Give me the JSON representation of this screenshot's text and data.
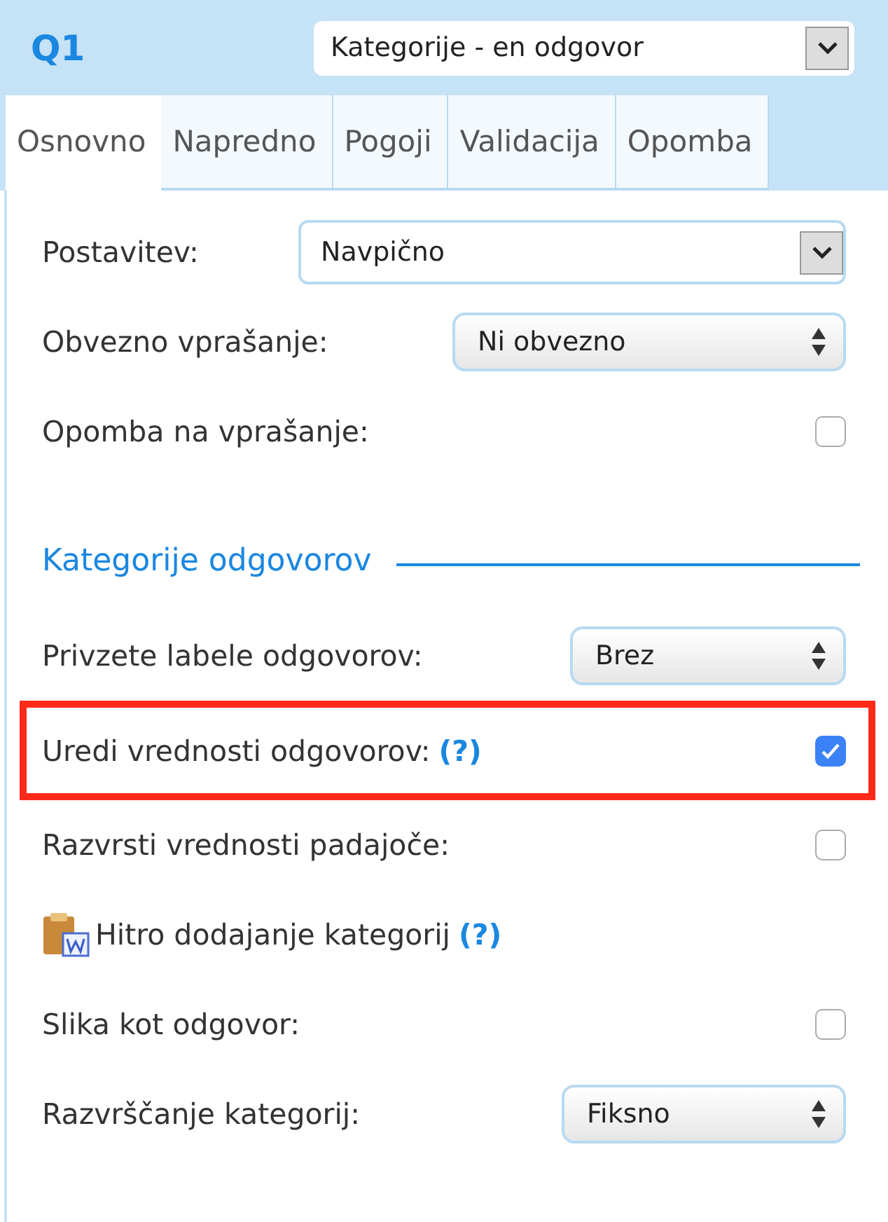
{
  "header": {
    "title": "Q1",
    "type_select": {
      "value": "Kategorije - en odgovor"
    }
  },
  "tabs": [
    {
      "label": "Osnovno",
      "selected": true
    },
    {
      "label": "Napredno",
      "selected": false
    },
    {
      "label": "Pogoji",
      "selected": false
    },
    {
      "label": "Validacija",
      "selected": false
    },
    {
      "label": "Opomba",
      "selected": false
    }
  ],
  "rows": [
    {
      "kind": "select",
      "label": "Postavitev:",
      "value": "Navpično",
      "highlighted": false
    },
    {
      "kind": "stepper",
      "label": "Obvezno vprašanje:",
      "value": "Ni obvezno",
      "highlighted": false
    },
    {
      "kind": "checkbox",
      "label": "Opomba na vprašanje:",
      "checked": false,
      "highlighted": false
    },
    {
      "kind": "section",
      "label": "Kategorije odgovorov",
      "highlighted": false
    },
    {
      "kind": "stepper",
      "label": "Privzete labele odgovorov:",
      "value": "Brez",
      "highlighted": false
    },
    {
      "kind": "checkbox",
      "label": "Uredi vrednosti odgovorov:",
      "help": "(?)",
      "checked": true,
      "highlighted": true
    },
    {
      "kind": "checkbox",
      "label": "Razvrsti vrednosti padajoče:",
      "checked": false,
      "highlighted": false
    },
    {
      "kind": "link",
      "label": "Hitro dodajanje kategorij",
      "help": "(?)",
      "highlighted": false
    },
    {
      "kind": "checkbox",
      "label": "Slika kot odgovor:",
      "checked": false,
      "highlighted": false
    },
    {
      "kind": "stepper",
      "label": "Razvrščanje kategorij:",
      "value": "Fiksno",
      "highlighted": false
    }
  ]
}
